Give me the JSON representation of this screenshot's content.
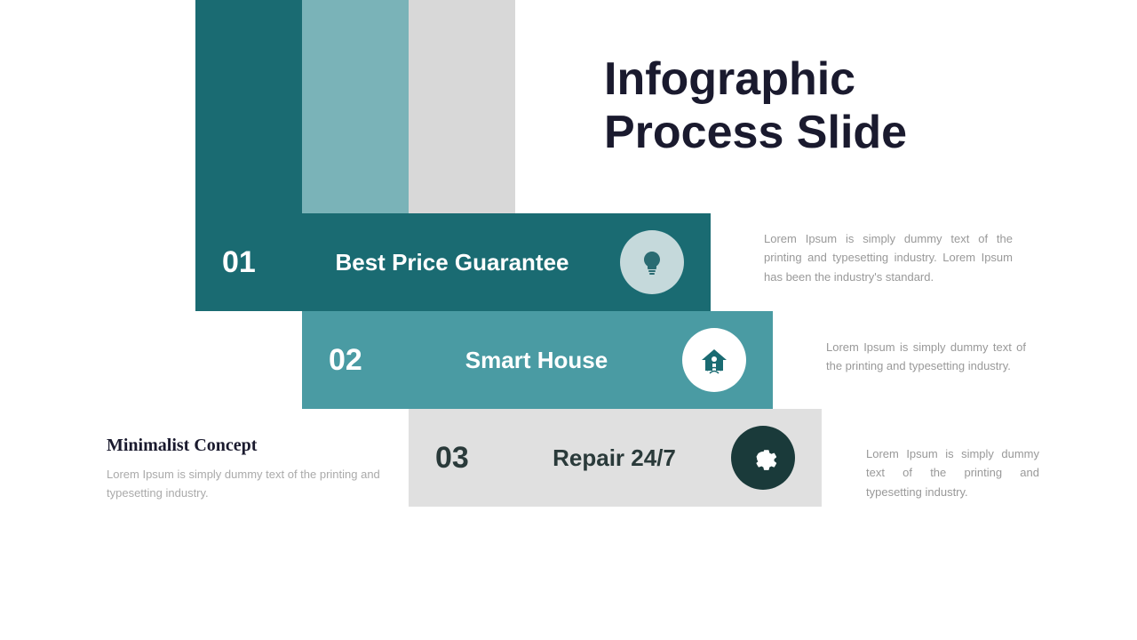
{
  "title": {
    "line1": "Infographic",
    "line2": "Process Slide"
  },
  "items": [
    {
      "number": "01",
      "label": "Best Price Guarantee",
      "icon": "lightbulb-icon",
      "description": "Lorem Ipsum is simply dummy text of the printing and typesetting industry. Lorem Ipsum has been the industry's standard."
    },
    {
      "number": "02",
      "label": "Smart House",
      "icon": "smart-house-icon",
      "description": "Lorem Ipsum is simply dummy text of the printing and typesetting industry."
    },
    {
      "number": "03",
      "label": "Repair 24/7",
      "icon": "gear-icon",
      "description": "Lorem Ipsum is simply dummy text of the printing and typesetting industry."
    }
  ],
  "concept": {
    "title": "Minimalist Concept",
    "description": "Lorem Ipsum is simply dummy text of the printing and typesetting industry."
  },
  "colors": {
    "dark_teal": "#1a6b72",
    "mid_teal": "#4a9ba3",
    "light_teal_bar": "#7ab3b8",
    "gray_bar": "#d8d8d8",
    "dark_circle": "#1a3a3a",
    "white": "#ffffff"
  }
}
